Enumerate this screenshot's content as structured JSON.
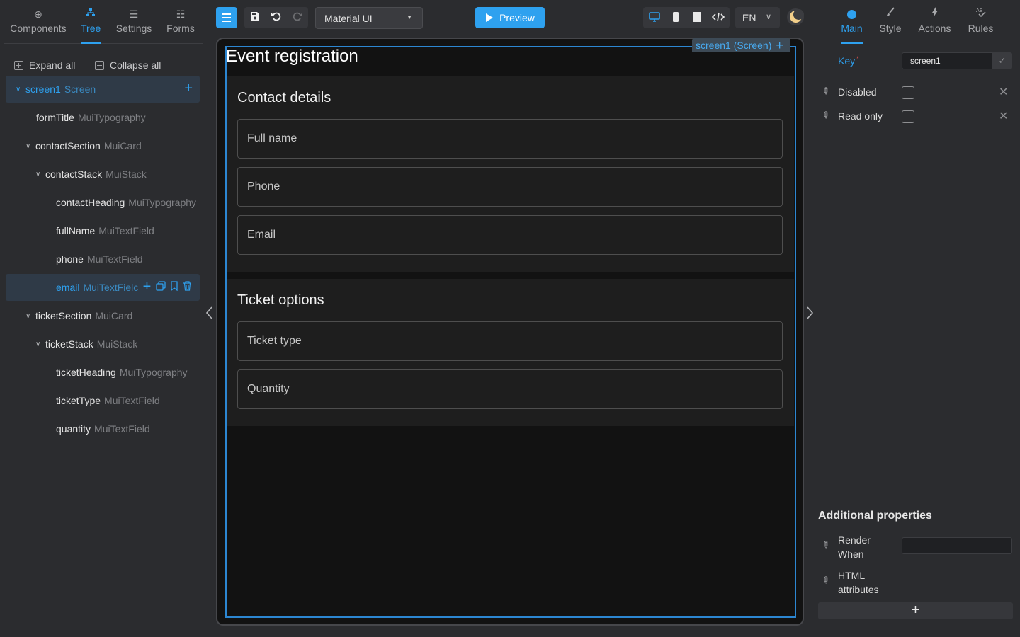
{
  "left_panel": {
    "tabs": [
      {
        "label": "Components",
        "icon": "plus-circle-icon"
      },
      {
        "label": "Tree",
        "icon": "hierarchy-icon"
      },
      {
        "label": "Settings",
        "icon": "sliders-icon"
      },
      {
        "label": "Forms",
        "icon": "list-icon"
      }
    ],
    "expand_all": "Expand all",
    "collapse_all": "Collapse all",
    "tree": [
      {
        "name": "screen1",
        "type": "Screen"
      },
      {
        "name": "formTitle",
        "type": "MuiTypography"
      },
      {
        "name": "contactSection",
        "type": "MuiCard"
      },
      {
        "name": "contactStack",
        "type": "MuiStack"
      },
      {
        "name": "contactHeading",
        "type": "MuiTypography"
      },
      {
        "name": "fullName",
        "type": "MuiTextField"
      },
      {
        "name": "phone",
        "type": "MuiTextField"
      },
      {
        "name": "email",
        "type": "MuiTextFielc"
      },
      {
        "name": "ticketSection",
        "type": "MuiCard"
      },
      {
        "name": "ticketStack",
        "type": "MuiStack"
      },
      {
        "name": "ticketHeading",
        "type": "MuiTypography"
      },
      {
        "name": "ticketType",
        "type": "MuiTextField"
      },
      {
        "name": "quantity",
        "type": "MuiTextField"
      }
    ]
  },
  "toolbar": {
    "theme": "Material UI",
    "preview": "Preview",
    "language": "EN"
  },
  "canvas": {
    "screen_tag": "screen1 (Screen)",
    "form_title": "Event registration",
    "contact_heading": "Contact details",
    "contact_fields": [
      "Full name",
      "Phone",
      "Email"
    ],
    "ticket_heading": "Ticket options",
    "ticket_fields": [
      "Ticket type",
      "Quantity"
    ]
  },
  "right_panel": {
    "tabs": [
      {
        "label": "Main",
        "icon": "dot-icon"
      },
      {
        "label": "Style",
        "icon": "brush-icon"
      },
      {
        "label": "Actions",
        "icon": "lightning-icon"
      },
      {
        "label": "Rules",
        "icon": "ab-check-icon"
      }
    ],
    "key_label": "Key",
    "key_required_mark": "*",
    "key_value": "screen1",
    "disabled_label": "Disabled",
    "readonly_label": "Read only",
    "additional_title": "Additional properties",
    "render_when_line1": "Render",
    "render_when_line2": "When",
    "html_attrs_line1": "HTML",
    "html_attrs_line2": "attributes"
  },
  "colors": {
    "accent": "#2ea1ef",
    "panel_bg": "#2b2c2f",
    "canvas_bg": "#121212",
    "card_bg": "#1e1e1e"
  }
}
